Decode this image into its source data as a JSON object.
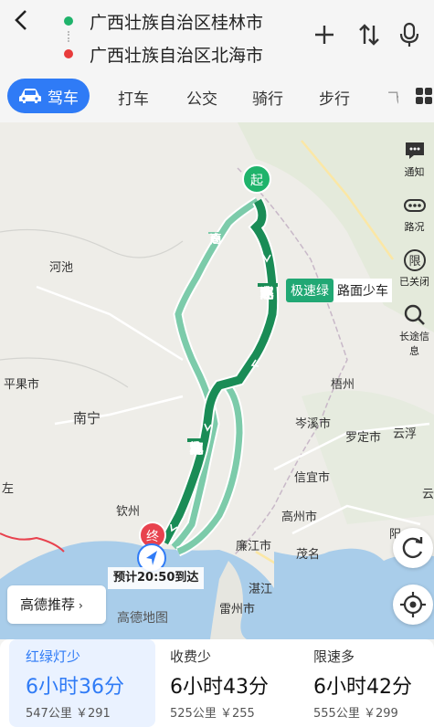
{
  "header": {
    "start": "广西壮族自治区桂林市",
    "end": "广西壮族自治区北海市",
    "icons": [
      "back-icon",
      "plus-icon",
      "swap-icon",
      "microphone-icon"
    ]
  },
  "tabs": {
    "active": "驾车",
    "items": [
      "打车",
      "公交",
      "骑行",
      "步行"
    ],
    "partial": "飞"
  },
  "map": {
    "cities": {
      "hechi": "河池",
      "pingguo": "平果市",
      "nanning": "南宁",
      "qinzhou": "钦州",
      "wuzhou": "梧州",
      "cenxi": "岑溪市",
      "luoding": "罗定市",
      "yunfu": "云浮",
      "xinyi": "信宜市",
      "gaozhou": "高州市",
      "lianjiang": "廉江市",
      "maoming": "茂名",
      "zhanjiang": "湛江",
      "leizhou": "雷州市",
      "yang": "阳",
      "zuo": "左",
      "yun": "云"
    },
    "roads": {
      "hubei": [
        "呼",
        "北",
        "高",
        "速"
      ],
      "liubei": [
        "柳",
        "北",
        "高",
        "速"
      ],
      "quannan": [
        "泉",
        "南",
        "高",
        "速"
      ]
    },
    "speed_badge": {
      "tag": "极速绿",
      "text": "路面少车"
    },
    "start_marker": "起",
    "end_marker": "终",
    "eta": "预计20:50到达",
    "logo": "高德地图",
    "recommend": "高德推荐",
    "recommend_chevron": "›"
  },
  "side_tools": {
    "notice": "通知",
    "traffic": "路况",
    "limit_icon_text": "限",
    "limit": "已关闭",
    "longtrip": "长途信息"
  },
  "routes": [
    {
      "tag": "红绿灯少",
      "time": "6小时36分",
      "meta": "547公里 ￥291"
    },
    {
      "tag": "收费少",
      "time": "6小时43分",
      "meta": "525公里 ￥255"
    },
    {
      "tag": "限速多",
      "time": "6小时42分",
      "meta": "555公里 ￥299"
    }
  ],
  "colors": {
    "accent": "#2f7bf6",
    "route_main": "#1a8c56",
    "route_alt": "#7ccbaa",
    "sea": "#a9cdea"
  }
}
